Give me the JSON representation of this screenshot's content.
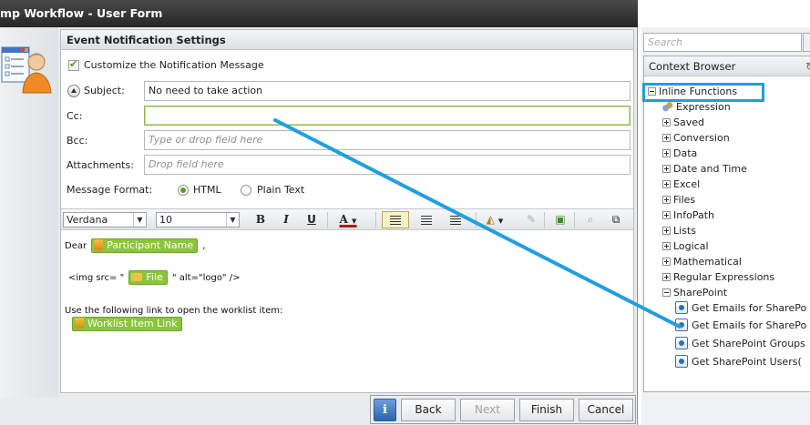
{
  "window": {
    "title": "mp Workflow - User Form"
  },
  "panel": {
    "header": "Event Notification Settings"
  },
  "form": {
    "customize_label": "Customize the Notification Message",
    "customize_checked": true,
    "subject_label": "Subject:",
    "subject_value": "No need to take action",
    "cc_label": "Cc:",
    "cc_value": "",
    "bcc_label": "Bcc:",
    "bcc_placeholder": "Type or drop field here",
    "attachments_label": "Attachments:",
    "attachments_placeholder": "Drop field here",
    "message_format_label": "Message Format:",
    "format_options": [
      "HTML",
      "Plain Text"
    ],
    "format_selected": "HTML"
  },
  "toolbar": {
    "font_family": "Verdana",
    "font_size": "10",
    "bold": "B",
    "italic": "I",
    "underline": "U",
    "font_color": "A"
  },
  "editor": {
    "line1_prefix": "Dear",
    "participant_token": "Participant Name",
    "line1_suffix": ",",
    "img_prefix": "<img src= \"",
    "file_token": "File",
    "img_suffix": "\" alt=\"logo\" />",
    "link_intro": "Use the following link to open the worklist item:",
    "worklist_token": "Worklist Item Link"
  },
  "buttons": {
    "back": "Back",
    "next": "Next",
    "finish": "Finish",
    "cancel": "Cancel",
    "next_enabled": false
  },
  "context_browser": {
    "search_placeholder": "Search",
    "title": "Context Browser",
    "tree": [
      {
        "label": "Inline Functions",
        "type": "expanded",
        "highlighted": true
      },
      {
        "label": "Expression",
        "type": "leaf-expression"
      },
      {
        "label": "Saved",
        "type": "collapsed"
      },
      {
        "label": "Conversion",
        "type": "collapsed"
      },
      {
        "label": "Data",
        "type": "collapsed"
      },
      {
        "label": "Date and Time",
        "type": "collapsed"
      },
      {
        "label": "Excel",
        "type": "collapsed"
      },
      {
        "label": "Files",
        "type": "collapsed"
      },
      {
        "label": "InfoPath",
        "type": "collapsed"
      },
      {
        "label": "Lists",
        "type": "collapsed"
      },
      {
        "label": "Logical",
        "type": "collapsed"
      },
      {
        "label": "Mathematical",
        "type": "collapsed"
      },
      {
        "label": "Regular Expressions",
        "type": "collapsed"
      },
      {
        "label": "SharePoint",
        "type": "expanded"
      },
      {
        "label": "Get Emails for SharePo",
        "type": "function"
      },
      {
        "label": "Get Emails for SharePo",
        "type": "function"
      },
      {
        "label": "Get SharePoint Groups",
        "type": "function"
      },
      {
        "label": "Get SharePoint Users(",
        "type": "function"
      }
    ]
  },
  "colors": {
    "accent_highlight": "#1f9fe0",
    "token_green": "#8cc43c",
    "titlebar": "#2b2b2b"
  }
}
